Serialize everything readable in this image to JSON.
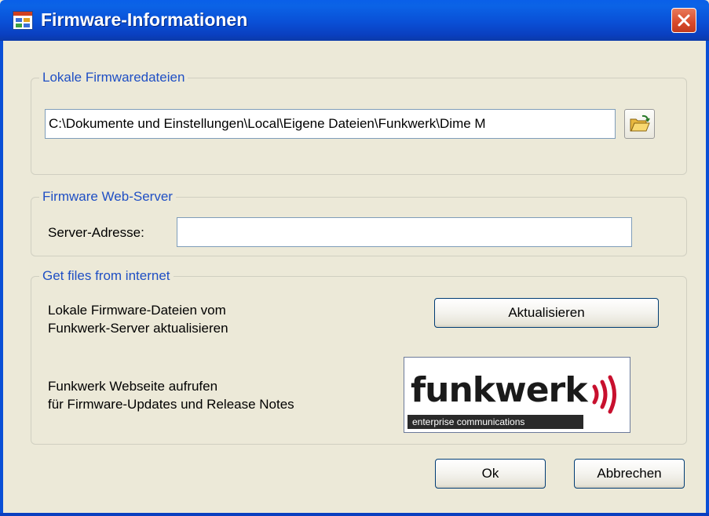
{
  "window": {
    "title": "Firmware-Informationen",
    "icon": "app-window-icon",
    "close_icon": "close-icon"
  },
  "local_files": {
    "legend": "Lokale Firmwaredateien",
    "path_value": "C:\\Dokumente und Einstellungen\\Local\\Eigene Dateien\\Funkwerk\\Dime M",
    "browse_icon": "open-folder-icon"
  },
  "web_server": {
    "legend": "Firmware Web-Server",
    "address_label": "Server-Adresse:",
    "address_value": ""
  },
  "internet": {
    "legend": "Get files from internet",
    "update_text_line1": "Lokale Firmware-Dateien vom",
    "update_text_line2": "Funkwerk-Server aktualisieren",
    "update_button": "Aktualisieren",
    "website_text_line1": "Funkwerk Webseite aufrufen",
    "website_text_line2": "für Firmware-Updates und Release Notes",
    "logo_wordmark": "funkwerk",
    "logo_tagline": "enterprise communications"
  },
  "footer": {
    "ok_button": "Ok",
    "cancel_button": "Abbrechen"
  },
  "colors": {
    "titlebar": "#0a4fd6",
    "legend_text": "#1f4fc4",
    "window_bg": "#ece9d8",
    "logo_accent": "#c8102e"
  }
}
